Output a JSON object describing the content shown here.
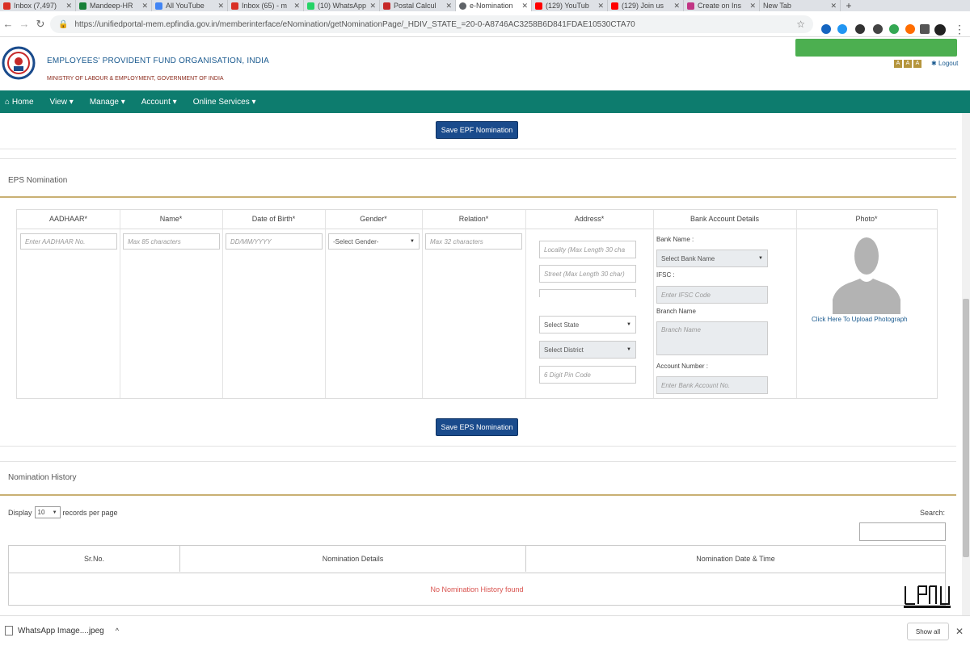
{
  "browser": {
    "tabs": [
      {
        "label": "Inbox (7,497)",
        "color": "#d93025",
        "active": false
      },
      {
        "label": "Mandeep-HR",
        "color": "#188038",
        "active": false
      },
      {
        "label": "All YouTube",
        "color": "#4285f4",
        "active": false
      },
      {
        "label": "Inbox (65) - m",
        "color": "#d93025",
        "active": false
      },
      {
        "label": "(10) WhatsApp",
        "color": "#25d366",
        "active": false
      },
      {
        "label": "Postal Calcul",
        "color": "#c62828",
        "active": false
      },
      {
        "label": "e-Nomination",
        "color": "#5f6368",
        "active": true
      },
      {
        "label": "(129) YouTub",
        "color": "#ff0000",
        "active": false
      },
      {
        "label": "(129) Join us",
        "color": "#ff0000",
        "active": false
      },
      {
        "label": "Create on Ins",
        "color": "#c13584",
        "active": false
      },
      {
        "label": "New Tab",
        "color": "#dee1e6",
        "active": false
      }
    ],
    "url": "https://unifiedportal-mem.epfindia.gov.in/memberinterface/eNomination/getNominationPage/_HDIV_STATE_=20-0-A8746AC3258B6D841FDAE10530CTA70",
    "extension_colors": [
      "#1565c0",
      "#2196f3",
      "#333333",
      "#444444",
      "#34a853",
      "#ff6d00",
      "#555555"
    ]
  },
  "header": {
    "org_name": "EMPLOYEES' PROVIDENT FUND ORGANISATION, INDIA",
    "ministry": "MINISTRY OF LABOUR & EMPLOYMENT, GOVERNMENT OF INDIA",
    "font_buttons": [
      "A",
      "A",
      "A"
    ],
    "logout": "Logout"
  },
  "nav": {
    "items": [
      "Home",
      "View ▾",
      "Manage ▾",
      "Account ▾",
      "Online Services ▾"
    ]
  },
  "epf": {
    "save_button": "Save EPF Nomination"
  },
  "eps": {
    "section_title": "EPS Nomination",
    "columns": [
      "AADHAAR*",
      "Name*",
      "Date of Birth*",
      "Gender*",
      "Relation*",
      "Address*",
      "Bank Account Details",
      "Photo*"
    ],
    "aadhaar_placeholder": "Enter AADHAAR No.",
    "name_placeholder": "Max 85 characters",
    "dob_placeholder": "DD/MM/YYYY",
    "gender_value": "-Select Gender-",
    "relation_placeholder": "Max 32 characters",
    "locality_placeholder": "Locality (Max Length 30 cha",
    "street_placeholder": "Street (Max Length 30 char)",
    "state_value": "Select State",
    "district_value": "Select District",
    "pin_placeholder": "6 Digit Pin Code",
    "bank_name_label": "Bank Name :",
    "bank_select_value": "Select Bank Name",
    "ifsc_label": "IFSC :",
    "ifsc_placeholder": "Enter IFSC Code",
    "branch_label": "Branch Name",
    "branch_placeholder": "Branch Name",
    "account_label": "Account Number :",
    "account_placeholder": "Enter Bank Account No.",
    "photo_upload": "Click Here To Upload Photograph",
    "save_button": "Save EPS Nomination"
  },
  "history": {
    "section_title": "Nomination History",
    "display_label": "Display",
    "display_value": "10",
    "records_label": "records per page",
    "search_label": "Search:",
    "columns": [
      "Sr.No.",
      "Nomination Details",
      "Nomination Date & Time"
    ],
    "empty_message": "No Nomination History found"
  },
  "downloads": {
    "file_name": "WhatsApp Image....jpeg",
    "show_all": "Show all"
  }
}
